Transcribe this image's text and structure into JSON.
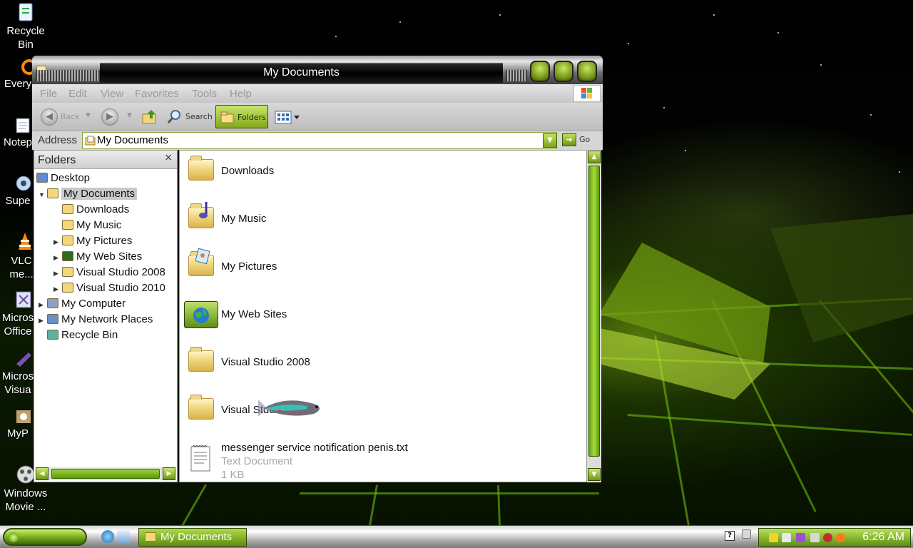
{
  "desktop": {
    "icons": [
      {
        "label": "Recycle Bin",
        "icon": "recycle-bin-icon"
      },
      {
        "label": "Every",
        "icon": "everything-icon"
      },
      {
        "label": "Notep",
        "icon": "notepad-icon"
      },
      {
        "label": "Supe",
        "icon": "super-icon"
      },
      {
        "label": "VLC me...",
        "icon": "vlc-icon"
      },
      {
        "label": "Micros Office",
        "icon": "office-icon"
      },
      {
        "label": "Micros Visua",
        "icon": "visual-studio-icon"
      },
      {
        "label": "MyP",
        "icon": "myp-icon"
      },
      {
        "label": "Windows Movie ...",
        "icon": "movie-maker-icon"
      }
    ]
  },
  "window": {
    "title": "My Documents",
    "menu": [
      "File",
      "Edit",
      "View",
      "Favorites",
      "Tools",
      "Help"
    ],
    "toolbar": {
      "back_label": "Back",
      "search_label": "Search",
      "folders_label": "Folders"
    },
    "address": {
      "label": "Address",
      "value": "My Documents",
      "go_label": "Go"
    },
    "folders_pane": {
      "title": "Folders",
      "close": "×",
      "tree": [
        {
          "label": "Desktop",
          "level": 0,
          "expander": "",
          "icon": "desktop-icon",
          "color": "#5d8bd8"
        },
        {
          "label": "My Documents",
          "level": 1,
          "expander": "▼",
          "icon": "my-documents-icon",
          "color": "#f3d87a",
          "selected": true
        },
        {
          "label": "Downloads",
          "level": 2,
          "expander": "",
          "icon": "folder-icon",
          "color": "#f3d87a"
        },
        {
          "label": "My Music",
          "level": 2,
          "expander": "",
          "icon": "music-folder-icon",
          "color": "#f3d87a"
        },
        {
          "label": "My Pictures",
          "level": 2,
          "expander": "▶",
          "icon": "pictures-folder-icon",
          "color": "#f3d87a"
        },
        {
          "label": "My Web Sites",
          "level": 2,
          "expander": "▶",
          "icon": "web-sites-icon",
          "color": "#2f6b1e"
        },
        {
          "label": "Visual Studio 2008",
          "level": 2,
          "expander": "▶",
          "icon": "folder-icon",
          "color": "#f3d87a"
        },
        {
          "label": "Visual Studio 2010",
          "level": 2,
          "expander": "▶",
          "icon": "folder-icon",
          "color": "#f3d87a"
        },
        {
          "label": "My Computer",
          "level": 1,
          "expander": "▶",
          "icon": "my-computer-icon",
          "color": "#8aa0c8"
        },
        {
          "label": "My Network Places",
          "level": 1,
          "expander": "▶",
          "icon": "network-places-icon",
          "color": "#6b8fc8"
        },
        {
          "label": "Recycle Bin",
          "level": 1,
          "expander": "",
          "icon": "recycle-bin-icon",
          "color": "#5fb0a0"
        }
      ]
    },
    "content": {
      "items": [
        {
          "name": "Downloads",
          "icon": "folder-icon"
        },
        {
          "name": "My Music",
          "icon": "music-folder-icon"
        },
        {
          "name": "My Pictures",
          "icon": "pictures-folder-icon"
        },
        {
          "name": "My Web Sites",
          "icon": "web-sites-icon"
        },
        {
          "name": "Visual Studio 2008",
          "icon": "folder-icon"
        },
        {
          "name": "Visual Studio",
          "icon": "folder-icon"
        }
      ],
      "text_file": {
        "name": "messenger service notification penis.txt",
        "type": "Text Document",
        "size": "1 KB",
        "icon": "text-document-icon"
      }
    }
  },
  "taskbar": {
    "task_button": "My Documents",
    "clock": "6:26 AM",
    "help_tray": "?"
  },
  "colors": {
    "accent_green": "#8cc02a",
    "titlebar_dark": "#000000",
    "selection_gray": "#c9c9c9"
  }
}
